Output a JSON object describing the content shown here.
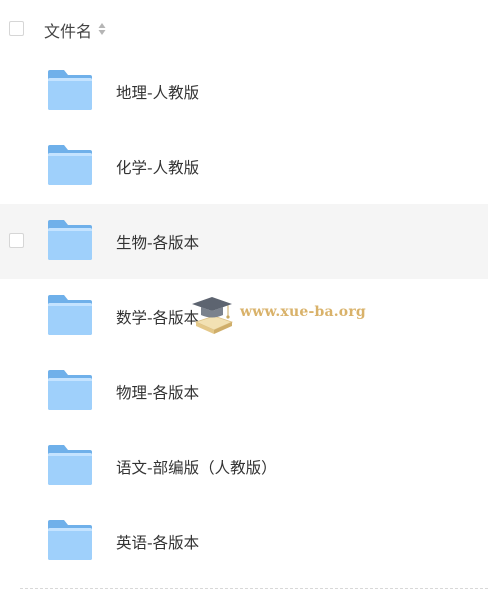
{
  "header": {
    "label": "文件名"
  },
  "files": [
    {
      "name": "地理-人教版"
    },
    {
      "name": "化学-人教版"
    },
    {
      "name": "生物-各版本",
      "selected": true
    },
    {
      "name": "数学-各版本"
    },
    {
      "name": "物理-各版本"
    },
    {
      "name": "语文-部编版（人教版）"
    },
    {
      "name": "英语-各版本"
    }
  ],
  "watermark": {
    "text": "www.xue-ba.org"
  },
  "colors": {
    "folder_back": "#6fb0ea",
    "folder_front": "#9fd0fb",
    "row_hover": "#f5f5f5"
  }
}
